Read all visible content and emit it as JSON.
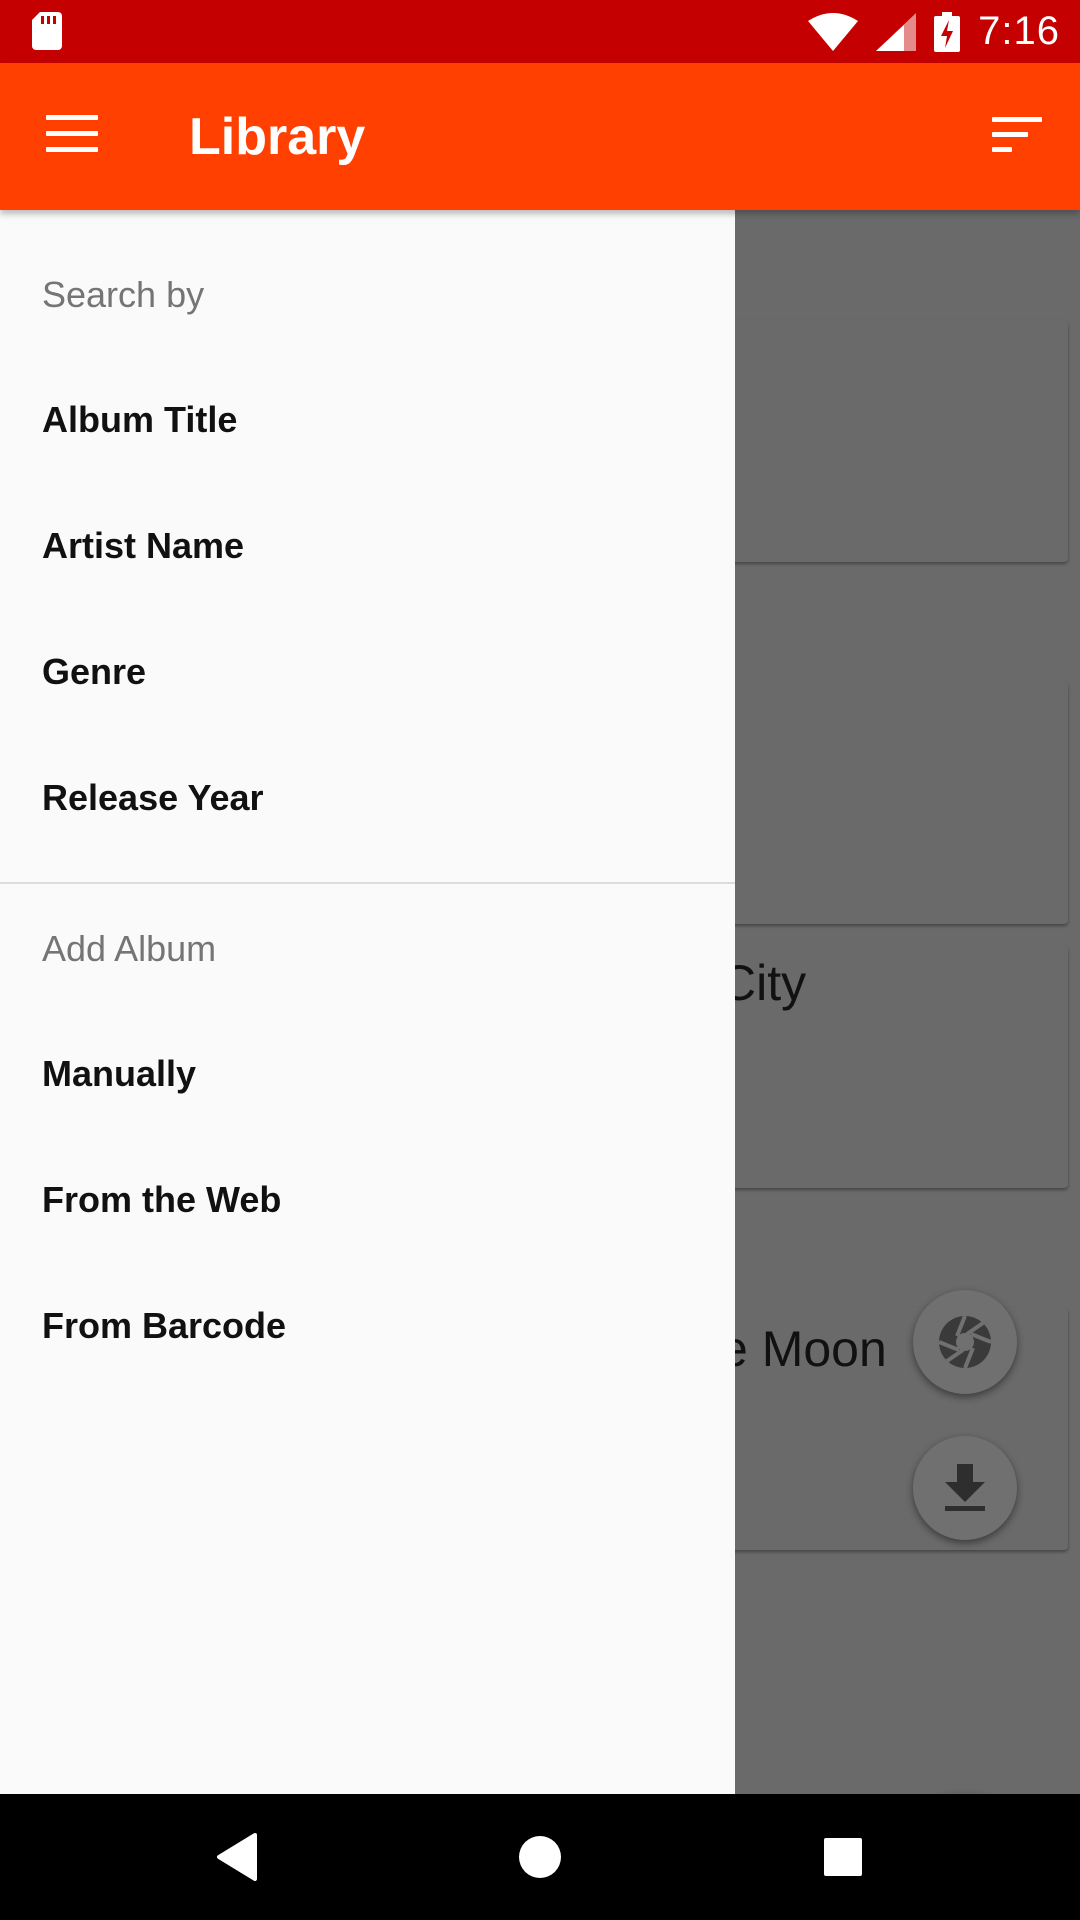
{
  "status_bar": {
    "time": "7:16",
    "icons": [
      "sd-card-icon",
      "wifi-icon",
      "signal-icon",
      "battery-charging-icon"
    ]
  },
  "app_bar": {
    "title": "Library",
    "menu_icon": "menu-icon",
    "sort_icon": "sort-icon"
  },
  "drawer": {
    "search_header": "Search by",
    "search_items": [
      "Album Title",
      "Artist Name",
      "Genre",
      "Release Year"
    ],
    "add_header": "Add Album",
    "add_items": [
      "Manually",
      "From the Web",
      "From Barcode"
    ]
  },
  "background": {
    "card_titles": [
      "",
      "",
      "City",
      "e Moon"
    ]
  },
  "fabs": {
    "camera_icon": "camera-icon",
    "download_icon": "download-icon",
    "add_icon": "plus-icon"
  },
  "colors": {
    "status_bar": "#c40000",
    "app_bar": "#ff4000",
    "fab": "#3a1389"
  }
}
